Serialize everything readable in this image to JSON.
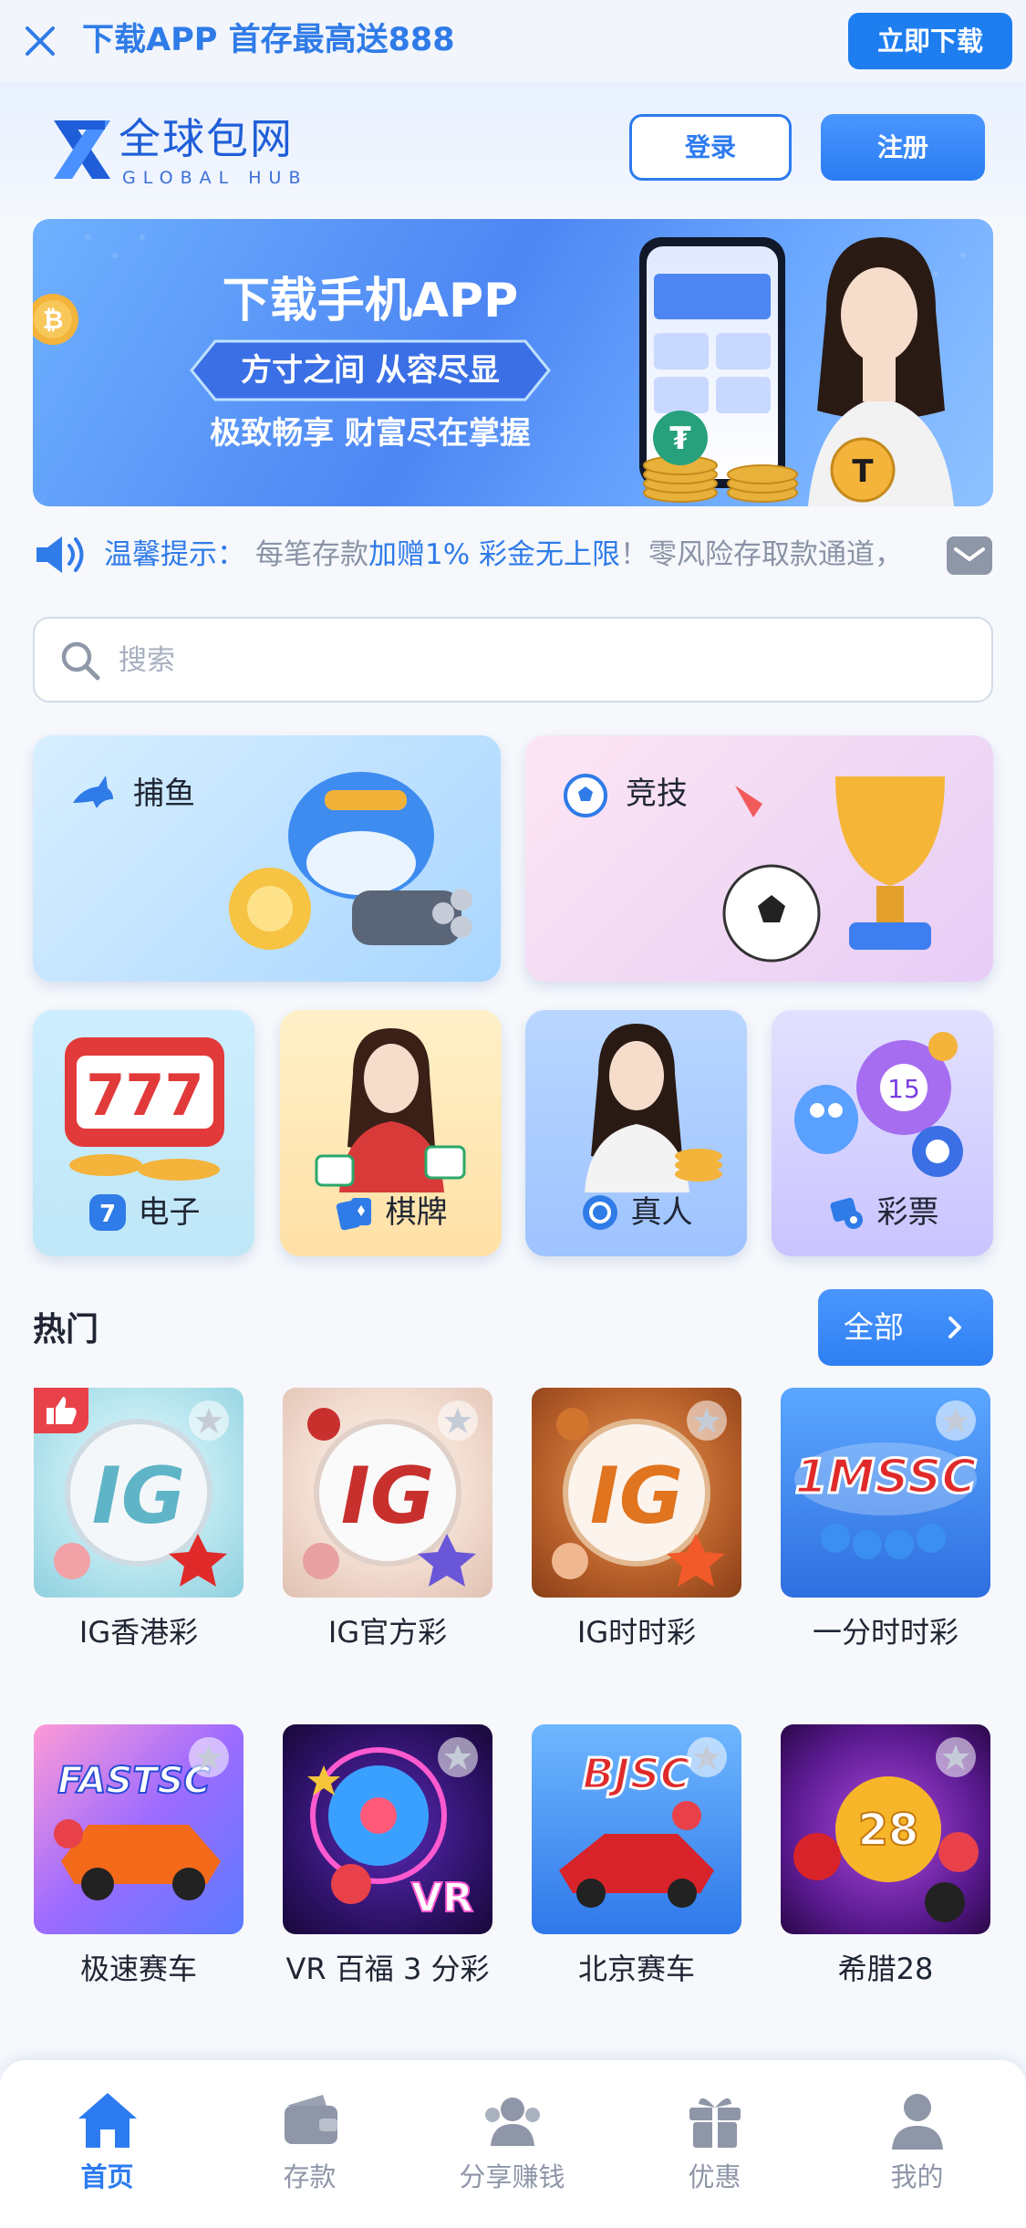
{
  "download_bar": {
    "text": "下载APP 首存最高送888",
    "button": "立即下载"
  },
  "header": {
    "logo_cn": "全球包网",
    "logo_en": "GLOBAL HUB",
    "login": "登录",
    "register": "注册"
  },
  "banner": {
    "title": "下载手机APP",
    "tagline": "方寸之间 从容尽显",
    "subtitle": "极致畅享 财富尽在掌握"
  },
  "notice": {
    "label": "温馨提示：",
    "text_a": "每笔存款",
    "text_b": "加赠1% 彩金无上限",
    "text_c": "！零风险存取款通道，"
  },
  "search": {
    "placeholder": "搜索"
  },
  "categories": {
    "fish": "捕鱼",
    "sport": "竞技",
    "slot": "电子",
    "chess": "棋牌",
    "live": "真人",
    "lottery": "彩票"
  },
  "hot": {
    "title": "热门",
    "all": "全部",
    "games": [
      {
        "name": "IG香港彩",
        "badge": "IG"
      },
      {
        "name": "IG官方彩",
        "badge": "IG"
      },
      {
        "name": "IG时时彩",
        "badge": "IG"
      },
      {
        "name": "一分时时彩",
        "badge": "1MSSC"
      },
      {
        "name": "极速赛车",
        "badge": "FASTSC"
      },
      {
        "name": "VR 百福 3 分彩",
        "badge": "VR"
      },
      {
        "name": "北京赛车",
        "badge": "BJSC"
      },
      {
        "name": "希腊28",
        "badge": "28"
      }
    ]
  },
  "tabbar": {
    "items": [
      {
        "label": "首页",
        "icon": "home-icon",
        "active": true
      },
      {
        "label": "存款",
        "icon": "wallet-icon",
        "active": false
      },
      {
        "label": "分享赚钱",
        "icon": "share-users-icon",
        "active": false
      },
      {
        "label": "优惠",
        "icon": "gift-icon",
        "active": false
      },
      {
        "label": "我的",
        "icon": "user-icon",
        "active": false
      }
    ]
  },
  "colors": {
    "accent": "#2d7bf0",
    "text": "#1f2533",
    "muted": "#8e96a8"
  }
}
